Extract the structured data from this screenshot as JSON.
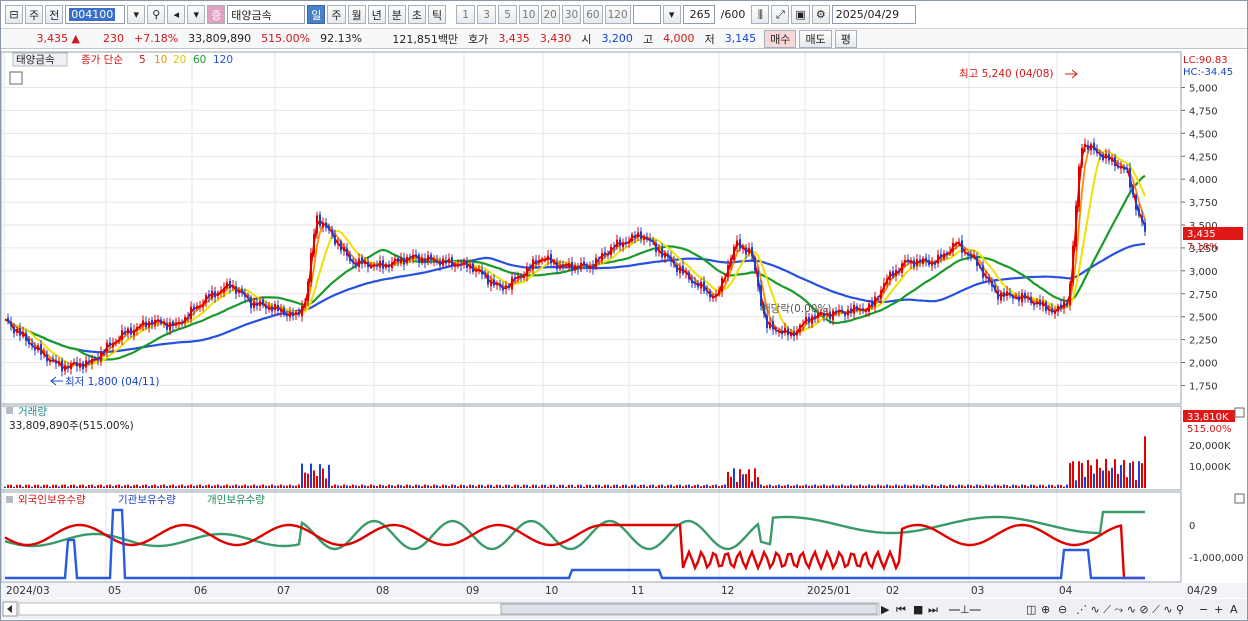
{
  "toolbar": {
    "mode": "주",
    "cur": "전",
    "code": "004100",
    "stock": "태양금속",
    "exch": "증",
    "periods": [
      "일",
      "주",
      "월",
      "년",
      "분",
      "초",
      "틱"
    ],
    "nums": [
      "1",
      "3",
      "5",
      "10",
      "20",
      "30",
      "60",
      "120"
    ],
    "count": "265",
    "total": "/600",
    "date": "2025/04/29"
  },
  "quote": {
    "price": "3,435",
    "arrow": "▲",
    "change": "230",
    "pct": "+7.18%",
    "volume": "33,809,890",
    "vol_ratio": "515.00%",
    "turnover": "92.13%",
    "amount": "121,851백만",
    "hoga_label": "호가",
    "ask": "3,435",
    "bid": "3,430",
    "open_label": "시",
    "open": "3,200",
    "high_label": "고",
    "high": "4,000",
    "low_label": "저",
    "low": "3,145",
    "buy": "매수",
    "sell": "매도",
    "flat": "평"
  },
  "price_panel": {
    "name": "태양금속",
    "legend_prefix": "종가 단순",
    "ma_labels": [
      "5",
      "10",
      "20",
      "60",
      "120"
    ],
    "lc": "LC:90.83",
    "hc": "HC:-34.45",
    "high_note": "최고 5,240 (04/08)",
    "low_note": "최저 1,800 (04/11)",
    "ex_note": "배당락(0.00%)",
    "last_tag": "3,435",
    "pct_tag": "7.18%",
    "yticks": [
      "5,000",
      "4,750",
      "4,500",
      "4,250",
      "4,000",
      "3,750",
      "3,500",
      "3,250",
      "3,000",
      "2,750",
      "2,500",
      "2,250",
      "2,000",
      "1,750"
    ]
  },
  "volume_panel": {
    "title": "거래량",
    "value": "33,809,890주(515.00%)",
    "tag": "33,810K",
    "tag2": "515.00%",
    "yticks": [
      "20,000K",
      "10,000K"
    ]
  },
  "holding_panel": {
    "series": [
      "외국인보유수량",
      "기관보유수량",
      "개인보유수량"
    ],
    "yticks": [
      "0",
      "-1,000,000"
    ]
  },
  "xaxis": [
    "2024/03",
    "05",
    "06",
    "07",
    "08",
    "09",
    "10",
    "11",
    "12",
    "2025/01",
    "02",
    "03",
    "04"
  ],
  "xaxis_right": "04/29",
  "colors": {
    "up": "#e00000",
    "down": "#1a3fd6",
    "ma5": "#e00000",
    "ma10": "#ff8c00",
    "ma20": "#f0e000",
    "ma60": "#1a9a2a",
    "ma120": "#2850e0"
  },
  "chart_data": {
    "type": "line",
    "x_range": [
      "2024/03",
      "2025/04/29"
    ],
    "y_range": [
      1700,
      5300
    ],
    "close_anchors": [
      [
        0,
        2500
      ],
      [
        40,
        2100
      ],
      [
        60,
        1950
      ],
      [
        90,
        2000
      ],
      [
        120,
        2300
      ],
      [
        150,
        2450
      ],
      [
        175,
        2400
      ],
      [
        205,
        2700
      ],
      [
        230,
        2850
      ],
      [
        250,
        2650
      ],
      [
        270,
        2600
      ],
      [
        295,
        2500
      ],
      [
        305,
        2700
      ],
      [
        315,
        3600
      ],
      [
        330,
        3400
      ],
      [
        350,
        3100
      ],
      [
        380,
        3050
      ],
      [
        410,
        3150
      ],
      [
        440,
        3100
      ],
      [
        470,
        3050
      ],
      [
        500,
        2800
      ],
      [
        520,
        2950
      ],
      [
        540,
        3150
      ],
      [
        560,
        3050
      ],
      [
        590,
        3050
      ],
      [
        610,
        3250
      ],
      [
        640,
        3400
      ],
      [
        660,
        3200
      ],
      [
        690,
        2900
      ],
      [
        715,
        2700
      ],
      [
        735,
        3300
      ],
      [
        750,
        3200
      ],
      [
        765,
        2400
      ],
      [
        790,
        2300
      ],
      [
        810,
        2500
      ],
      [
        840,
        2550
      ],
      [
        870,
        2600
      ],
      [
        885,
        2900
      ],
      [
        905,
        3100
      ],
      [
        935,
        3100
      ],
      [
        955,
        3300
      ],
      [
        975,
        3100
      ],
      [
        995,
        2750
      ],
      [
        1025,
        2700
      ],
      [
        1055,
        2550
      ],
      [
        1068,
        2700
      ],
      [
        1080,
        4400
      ],
      [
        1095,
        4300
      ],
      [
        1110,
        4200
      ],
      [
        1125,
        4100
      ],
      [
        1135,
        3700
      ],
      [
        1143,
        3435
      ]
    ],
    "volume_bars_k": [
      {
        "x": "07",
        "v": 20000
      },
      {
        "x": "12",
        "v": 15000
      },
      {
        "x": "04/08",
        "v": 25000
      },
      {
        "x": "04/29",
        "v": 33810
      }
    ]
  }
}
